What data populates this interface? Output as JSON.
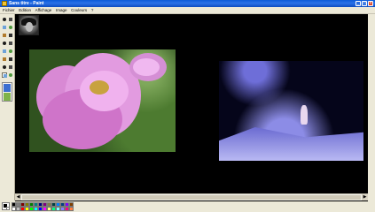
{
  "window": {
    "title": "Sans titre - Paint",
    "min_icon": "minimize-icon",
    "max_icon": "maximize-icon",
    "close_icon": "close-icon"
  },
  "menu": [
    "Fichier",
    "Edition",
    "Affichage",
    "Image",
    "Couleurs",
    "?"
  ],
  "tools": [
    "free-select",
    "rect-select",
    "eraser",
    "fill",
    "picker",
    "magnifier",
    "pencil",
    "brush",
    "airbrush",
    "text",
    "line",
    "curve",
    "rectangle",
    "polygon",
    "ellipse",
    "rounded-rect"
  ],
  "palette_colors": [
    "#000000",
    "#808080",
    "#800000",
    "#808000",
    "#008000",
    "#008080",
    "#000080",
    "#800080",
    "#808040",
    "#004040",
    "#0080ff",
    "#004080",
    "#8000ff",
    "#804000",
    "#ffffff",
    "#c0c0c0",
    "#ff0000",
    "#ffff00",
    "#00ff00",
    "#00ffff",
    "#0000ff",
    "#ff00ff",
    "#ffff80",
    "#00ff80",
    "#80ffff",
    "#8080ff",
    "#ff0080",
    "#ff8040"
  ]
}
